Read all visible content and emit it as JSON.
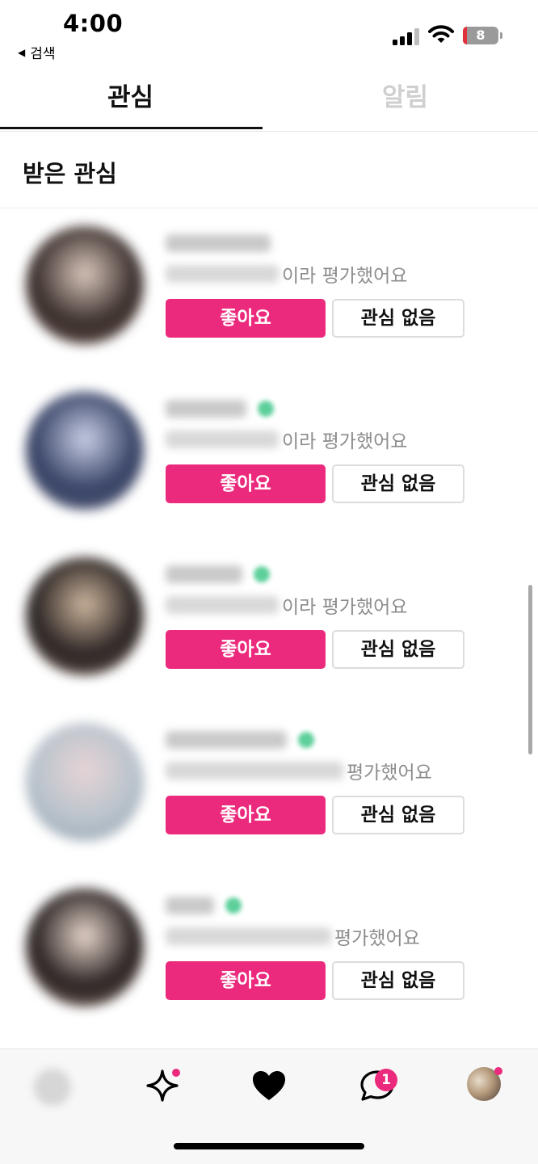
{
  "status_bar": {
    "time": "4:00",
    "back_label": "검색",
    "back_icon": "triangle-left-icon",
    "battery_level": "8",
    "battery_color": "#e0313b",
    "icons": [
      "cellular-signal-icon",
      "wifi-icon",
      "battery-icon"
    ]
  },
  "tabs": [
    {
      "label": "관심",
      "active": true
    },
    {
      "label": "알림",
      "active": false
    }
  ],
  "section": {
    "title": "받은 관심"
  },
  "list": {
    "items": [
      {
        "rating_text": "이라 평가했어요",
        "like_label": "좋아요",
        "pass_label": "관심 없음",
        "verified": false,
        "avatar_colors": [
          "#d9c7bc",
          "#3a2f2c",
          "#6f5a52"
        ]
      },
      {
        "rating_text": "이라 평가했어요",
        "like_label": "좋아요",
        "pass_label": "관심 없음",
        "verified": true,
        "avatar_colors": [
          "#c9cfe6",
          "#384366",
          "#5a5f77"
        ]
      },
      {
        "rating_text": "이라 평가했어요",
        "like_label": "좋아요",
        "pass_label": "관심 없음",
        "verified": true,
        "avatar_colors": [
          "#cdb59d",
          "#2b2524",
          "#7b6658"
        ]
      },
      {
        "rating_text": "평가했어요",
        "like_label": "좋아요",
        "pass_label": "관심 없음",
        "verified": true,
        "avatar_colors": [
          "#e6d4d6",
          "#b9c3cc",
          "#8b9aa7"
        ]
      },
      {
        "rating_text": "평가했어요",
        "like_label": "좋아요",
        "pass_label": "관심 없음",
        "verified": true,
        "avatar_colors": [
          "#e7d6cc",
          "#2a2322",
          "#8b7468"
        ]
      }
    ]
  },
  "bottom_nav": {
    "items": [
      "home-icon",
      "sparkle-icon",
      "heart-icon",
      "chat-icon",
      "profile-avatar"
    ],
    "chat_badge": "1",
    "accent_color": "#ec2a7d"
  }
}
